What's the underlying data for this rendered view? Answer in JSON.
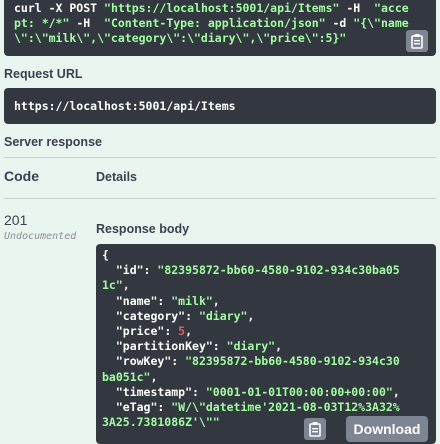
{
  "curl": {
    "line1": "curl -X POST ",
    "url": "\"https://localhost:5001/api/Items\"",
    "h1_flag": " -H  ",
    "accept": "\"accept: */*\"",
    "h2_flag": " -H  ",
    "content_type": "\"Content-Type: application/json\"",
    "d_flag": " -d ",
    "payload": "\"{\\\"name\\\":\\\"milk\\\",\\\"category\\\":\\\"diary\\\",\\\"price\\\":5}\"",
    "copy_icon": "clipboard-icon"
  },
  "request_url": {
    "label": "Request URL",
    "value": "https://localhost:5001/api/Items"
  },
  "server_response": {
    "label": "Server response",
    "columns": {
      "code": "Code",
      "details": "Details"
    },
    "code": "201",
    "code_note": "Undocumented",
    "body_label": "Response body",
    "body": {
      "open": "{",
      "id_key": "\"id\": ",
      "id_val": "\"82395872-bb60-4580-9102-934c30ba051c\"",
      "name_key": "\"name\": ",
      "name_val": "\"milk\"",
      "category_key": "\"category\": ",
      "category_val": "\"diary\"",
      "price_key": "\"price\": ",
      "price_val": "5",
      "partition_key": "\"partitionKey\": ",
      "partition_val": "\"diary\"",
      "row_key": "\"rowKey\": ",
      "row_val": "\"82395872-bb60-4580-9102-934c30ba051c\"",
      "timestamp_key": "\"timestamp\": ",
      "timestamp_val": "\"0001-01-01T00:00:00+00:00\"",
      "etag_key": "\"eTag\": ",
      "etag_val": "\"W/\\\"datetime'2021-08-03T12%3A32%3A25.7381086Z'\\\"\""
    },
    "copy_icon": "clipboard-icon",
    "download_label": "Download"
  }
}
